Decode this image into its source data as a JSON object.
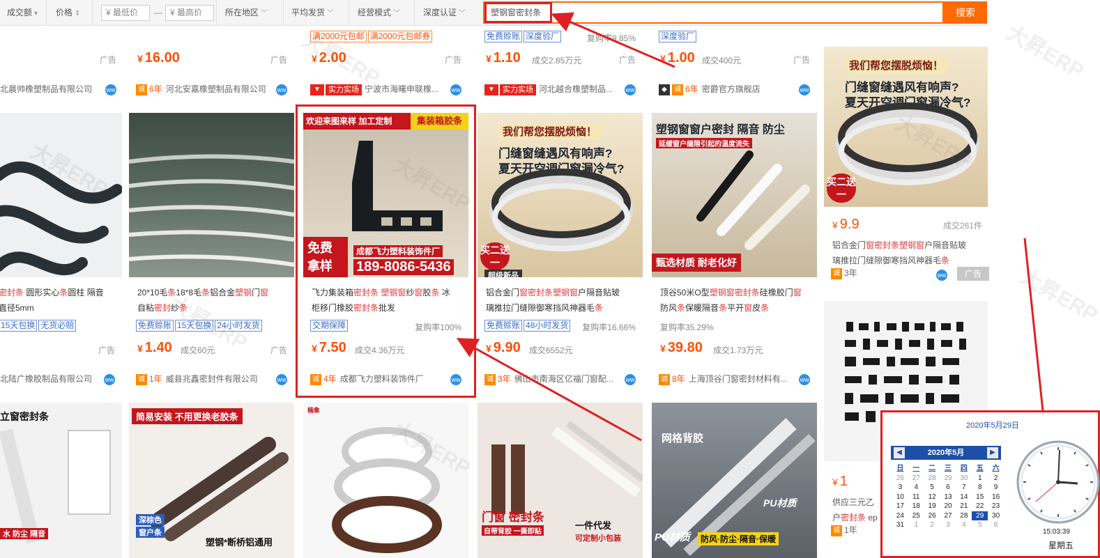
{
  "filterbar": {
    "volume": "成交额",
    "price": "价格",
    "min_price": "¥ 最低价",
    "dash": "—",
    "max_price": "¥ 最高价",
    "region": "所在地区",
    "ship_time": "平均发货",
    "biz_mode": "经营模式",
    "deep_cert": "深度认证",
    "search_value": "塑钢窗密封条",
    "search_button": "搜索"
  },
  "watermark": "大昇ERP",
  "row1": [
    {
      "tags": [],
      "price": "",
      "deal": "",
      "ad": "广告",
      "shop": "北晨帅橡塑制品有限公司",
      "yrs": ""
    },
    {
      "tags": [],
      "price": "16.00",
      "deal": "",
      "ad": "广告",
      "shop": "河北安嘉橡塑制品有限公司",
      "yrs": "6年"
    },
    {
      "tags": [
        "满2000元包邮",
        "满2000元包邮券"
      ],
      "price": "2.00",
      "deal": "",
      "ad": "广告",
      "shop": "宁波市海曙申联橡...",
      "power": "实力实场"
    },
    {
      "tags": [
        "免费赊账",
        "深度验厂"
      ],
      "rebuy": "复购率9.85%",
      "price": "1.10",
      "deal": "成交2.85万元",
      "ad": "广告",
      "shop": "河北越合橡塑制品...",
      "power": "实力实场"
    },
    {
      "tags": [
        "深度验厂"
      ],
      "price": "1.00",
      "deal": "成交400元",
      "ad": "广告",
      "shop": "密爵官方旗舰店",
      "yrs": "6年"
    }
  ],
  "row2": [
    {
      "img_label": "",
      "title_parts": [
        [
          "密封条",
          true
        ],
        [
          " 圆形实心",
          false
        ],
        [
          "条",
          true
        ],
        [
          "圆柱 隔音",
          false
        ]
      ],
      "title2": "直径5mm",
      "tags": [
        "15天包换",
        "无货必赔"
      ],
      "price": "",
      "deal": "",
      "ad": "广告",
      "shop": "北陆广橡胶制品有限公司",
      "yrs": ""
    },
    {
      "img_label": "",
      "title_parts": [
        [
          "20*10毛",
          false
        ],
        [
          "条",
          true
        ],
        [
          "18*8毛",
          false
        ],
        [
          "条",
          true
        ],
        [
          "铝合金",
          false
        ],
        [
          "塑钢",
          true
        ],
        [
          "门",
          false
        ],
        [
          "窗",
          true
        ]
      ],
      "title2_parts": [
        [
          "自粘",
          false
        ],
        [
          "密封",
          true
        ],
        [
          "纱",
          false
        ],
        [
          "条",
          true
        ]
      ],
      "tags": [
        "免费赊账",
        "15天包换",
        "24小时发货"
      ],
      "price": "1.40",
      "deal": "成交60元",
      "ad": "广告",
      "shop": "威县兆鑫密封件有限公司",
      "yrs": "1年"
    },
    {
      "img_label1": "欢迎来图来样 加工定制",
      "img_label2": "集装箱胶条",
      "img_label3": "免费拿样",
      "img_label4": "成都飞力塑料装饰件厂",
      "img_label5": "189-8086-5436",
      "title_parts": [
        [
          "飞力集装箱",
          false
        ],
        [
          "密封条",
          true
        ],
        [
          " ",
          false
        ],
        [
          "塑钢窗",
          true
        ],
        [
          "纱",
          false
        ],
        [
          "窗",
          true
        ],
        [
          "胶",
          false
        ],
        [
          "条",
          true
        ],
        [
          " 冰",
          false
        ]
      ],
      "title2_parts": [
        [
          "柜移门橡胶",
          false
        ],
        [
          "密封条",
          true
        ],
        [
          "批发",
          false
        ]
      ],
      "tags": [
        "交期保障"
      ],
      "rebuy": "复购率100%",
      "price": "7.50",
      "deal": "成交4.36万元",
      "ad": "",
      "shop": "成都飞力塑料装饰件厂",
      "yrs": "4年"
    },
    {
      "img_label1": "我们帮您摆脱烦恼！",
      "img_label2": "门缝窗缝遇风有响声?",
      "img_label3": "夏天开空调门窗漏冷气?",
      "img_label4": "买二送一",
      "img_label5": "超级新品",
      "title_parts": [
        [
          "铝合金门",
          false
        ],
        [
          "窗密封条塑钢窗",
          true
        ],
        [
          "户隔音贴玻",
          false
        ]
      ],
      "title2_parts": [
        [
          "璃推拉门缝隙御寒挡风神器毛",
          false
        ],
        [
          "条",
          true
        ]
      ],
      "tags": [
        "免费赊账",
        "48小时发货"
      ],
      "rebuy": "复购率16.66%",
      "price": "9.90",
      "deal": "成交6552元",
      "ad": "",
      "shop": "佛山市南海区亿福门窗配...",
      "yrs": "3年"
    },
    {
      "img_label1": "塑钢窗窗户密封 隔音 防尘",
      "img_label2": "延缓窗户缝隙引起的温度流失",
      "img_label3": "甄选材质 耐老化好",
      "title_parts": [
        [
          "顶谷50米O型",
          false
        ],
        [
          "塑钢窗密封条",
          true
        ],
        [
          "硅橡胶门",
          false
        ],
        [
          "窗",
          true
        ]
      ],
      "title2_parts": [
        [
          "防风",
          false
        ],
        [
          "条",
          true
        ],
        [
          "保暖隔音",
          false
        ],
        [
          "条",
          true
        ],
        [
          "平开",
          false
        ],
        [
          "窗",
          true
        ],
        [
          "皮",
          false
        ],
        [
          "条",
          true
        ]
      ],
      "tags": [],
      "rebuy": "复购率35.29%",
      "price": "39.80",
      "deal": "成交1.73万元",
      "ad": "",
      "shop": "上海顶谷门窗密封材料有...",
      "yrs": "8年"
    }
  ],
  "row3": [
    {
      "img_label1": "立窗密封条",
      "img_label2": "水 防尘 隔音"
    },
    {
      "img_label1": "简易安装 不用更换老胶条",
      "img_label2": "深棕色",
      "img_label3": "窗户条",
      "img_label4": "塑钢*断桥铝通用"
    },
    {
      "img_label1": "楠象"
    },
    {
      "img_label1": "门窗 密封条",
      "img_label2": "自带背胶 一撕即贴",
      "img_label3": "一件代发",
      "img_label4": "可定制小包装"
    },
    {
      "img_label1": "网格背胶",
      "img_label2": "PU材质",
      "img_label3": "PU材质",
      "img_label4": "防风·防尘·隔音·保暖"
    }
  ],
  "side": [
    {
      "img_label1": "我们帮您摆脱烦恼！",
      "img_label2": "门缝窗缝遇风有响声?",
      "img_label3": "夏天开空调门窗漏冷气?",
      "img_label4": "买二送一",
      "price": "9.9",
      "deal": "成交261件",
      "title_parts": [
        [
          "铝合金门",
          false
        ],
        [
          "窗密封条塑钢窗",
          true
        ],
        [
          "户隔音贴玻",
          false
        ]
      ],
      "title2_parts": [
        [
          "璃推拉门缝隙御寒挡风神器毛",
          false
        ],
        [
          "条",
          true
        ]
      ],
      "yrs": "3年",
      "ad": "广告"
    },
    {
      "price": "1",
      "title1": "供应三元乙",
      "title2_parts": [
        [
          "户",
          false
        ],
        [
          "密封条",
          true
        ],
        [
          " ep",
          false
        ]
      ],
      "yrs": "1年"
    }
  ],
  "calendar": {
    "date_head": "2020年5月29日",
    "month_label": "2020年5月",
    "weekdays": [
      "日",
      "一",
      "二",
      "三",
      "四",
      "五",
      "六"
    ],
    "weeks": [
      [
        "26",
        "27",
        "28",
        "29",
        "30",
        "1",
        "2"
      ],
      [
        "3",
        "4",
        "5",
        "6",
        "7",
        "8",
        "9"
      ],
      [
        "10",
        "11",
        "12",
        "13",
        "14",
        "15",
        "16"
      ],
      [
        "17",
        "18",
        "19",
        "20",
        "21",
        "22",
        "23"
      ],
      [
        "24",
        "25",
        "26",
        "27",
        "28",
        "29",
        "30"
      ],
      [
        "31",
        "1",
        "2",
        "3",
        "4",
        "5",
        "6"
      ]
    ],
    "selected": "29",
    "time": "15:03:39",
    "weekday": "星期五"
  },
  "colors": {
    "accent": "#ff6a00",
    "price": "#ff5000",
    "annotation": "#e02020",
    "highlight": "#e4393c"
  }
}
